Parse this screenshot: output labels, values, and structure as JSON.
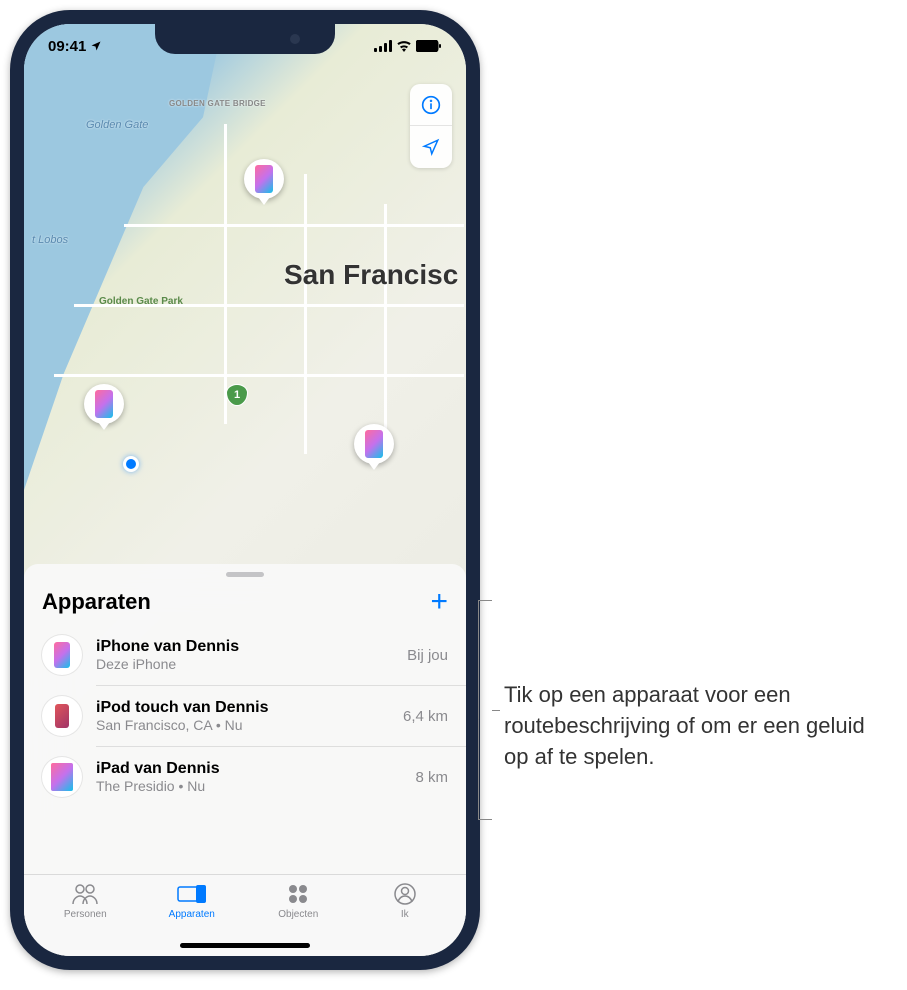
{
  "status": {
    "time": "09:41"
  },
  "map": {
    "city_label": "San Francisc",
    "golden_gate_label": "Golden Gate",
    "pt_lobos_label": "t Lobos",
    "bridge_label": "GOLDEN GATE BRIDGE",
    "park_label": "Golden Gate Park",
    "highway_shield": "1"
  },
  "sheet": {
    "title": "Apparaten"
  },
  "devices": [
    {
      "name": "iPhone van Dennis",
      "subtitle": "Deze iPhone",
      "distance": "Bij jou"
    },
    {
      "name": "iPod touch van Dennis",
      "subtitle": "San Francisco, CA • Nu",
      "distance": "6,4 km"
    },
    {
      "name": "iPad van Dennis",
      "subtitle": "The Presidio • Nu",
      "distance": "8 km"
    }
  ],
  "tabs": {
    "people": "Personen",
    "devices": "Apparaten",
    "items": "Objecten",
    "me": "Ik"
  },
  "callout": {
    "text": "Tik op een apparaat voor een routebeschrijving of om er een geluid op af te spelen."
  }
}
